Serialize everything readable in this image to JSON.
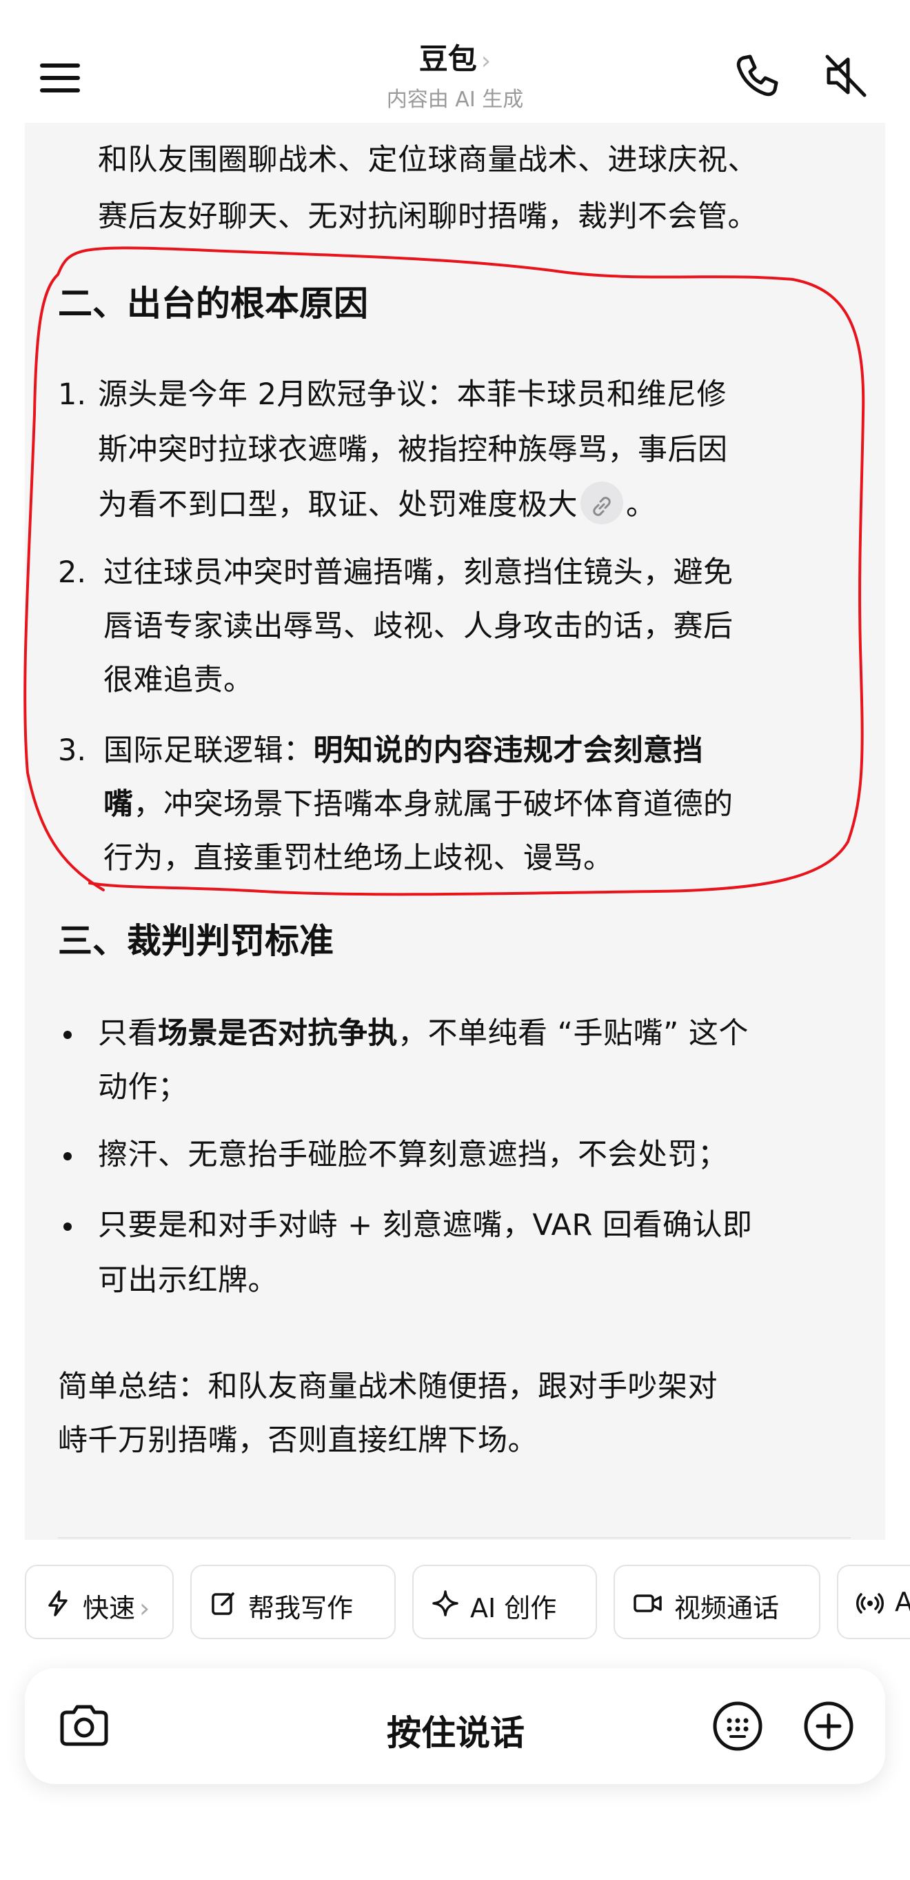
{
  "header": {
    "title": "豆包",
    "title_chevron": "›",
    "subtitle": "内容由 AI 生成",
    "icons": [
      "menu-icon",
      "phone-icon",
      "mute-icon"
    ]
  },
  "content": {
    "intro_lines": [
      "和队友围圈聊战术、定位球商量战术、进球庆祝、",
      "赛后友好聊天、无对抗闲聊时捂嘴，裁判不会管。"
    ],
    "section2": {
      "heading": "二、出台的根本原因",
      "items": [
        {
          "num": "1.",
          "lines": [
            "源头是今年 2月欧冠争议：本菲卡球员和维尼修",
            "斯冲突时拉球衣遮嘴，被指控种族辱骂，事后因",
            "为看不到口型，取证、处罚难度极大"
          ],
          "tail": "。"
        },
        {
          "num": "2.",
          "lines": [
            "过往球员冲突时普遍捂嘴，刻意挡住镜头，避免",
            "唇语专家读出辱骂、歧视、人身攻击的话，赛后",
            "很难追责。"
          ]
        },
        {
          "num": "3.",
          "line1_prefix": "国际足联逻辑：",
          "line1_bold": "明知说的内容违规才会刻意挡",
          "line2_bold": "嘴",
          "line2_rest": "，冲突场景下捂嘴本身就属于破坏体育道德的",
          "line3": "行为，直接重罚杜绝场上歧视、谩骂。"
        }
      ]
    },
    "section3": {
      "heading": "三、裁判判罚标准",
      "bullets": [
        {
          "prefix": "只看",
          "bold": "场景是否对抗争执",
          "rest": "，不单纯看 “手贴嘴” 这个",
          "line2": "动作；"
        },
        {
          "line1": "擦汗、无意抬手碰脸不算刻意遮挡，不会处罚；"
        },
        {
          "line1": "只要是和对手对峙 + 刻意遮嘴，VAR 回看确认即",
          "line2": "可出示红牌。"
        }
      ]
    },
    "summary_lines": [
      "简单总结：和队友商量战术随便捂，跟对手吵架对",
      "峙千万别捂嘴，否则直接红牌下场。"
    ]
  },
  "actions": [
    "copy-icon",
    "speaker-icon",
    "bookmark-icon",
    "share-icon",
    "refresh-icon"
  ],
  "chips": [
    {
      "label": "快速",
      "suffix": "›",
      "icon": "lightning-icon"
    },
    {
      "label": "帮我写作",
      "icon": "edit-icon"
    },
    {
      "label": "AI 创作",
      "icon": "sparkle-icon"
    },
    {
      "label": "视频通话",
      "icon": "video-icon"
    },
    {
      "label": "A",
      "icon": "broadcast-icon"
    }
  ],
  "input_bar": {
    "hold_to_talk": "按住说话",
    "icons": [
      "camera-icon",
      "keyboard-icon",
      "plus-icon"
    ]
  },
  "colors": {
    "annotation_red": "#e8141c",
    "card_bg": "#f5f5f6",
    "action_bg": "#e8eefb",
    "action_icon": "#2a6ae0"
  }
}
